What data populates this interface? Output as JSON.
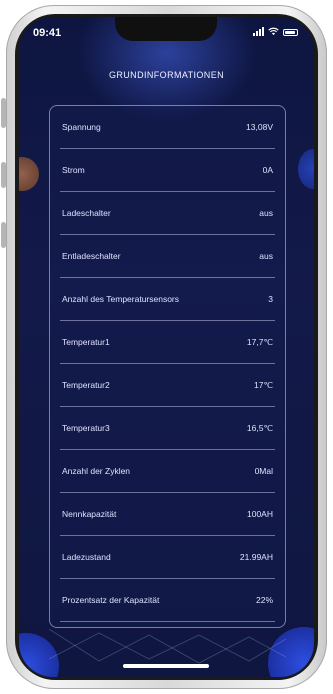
{
  "status_bar": {
    "time": "09:41"
  },
  "header": {
    "title": "GRUNDINFORMATIONEN"
  },
  "rows": [
    {
      "label": "Spannung",
      "value": "13,08V"
    },
    {
      "label": "Strom",
      "value": "0A"
    },
    {
      "label": "Ladeschalter",
      "value": "aus"
    },
    {
      "label": "Entladeschalter",
      "value": "aus"
    },
    {
      "label": "Anzahl des Temperatursensors",
      "value": "3"
    },
    {
      "label": "Temperatur1",
      "value": "17,7℃"
    },
    {
      "label": "Temperatur2",
      "value": "17℃"
    },
    {
      "label": "Temperatur3",
      "value": "16,5℃"
    },
    {
      "label": "Anzahl der Zyklen",
      "value": "0Mal"
    },
    {
      "label": "Nennkapazität",
      "value": "100AH"
    },
    {
      "label": "Ladezustand",
      "value": "21.99AH"
    },
    {
      "label": "Prozentsatz der Kapazität",
      "value": "22%"
    }
  ],
  "colors": {
    "background": "#131a4a",
    "accent": "#2d4ee0",
    "text": "#dfe3ff"
  }
}
